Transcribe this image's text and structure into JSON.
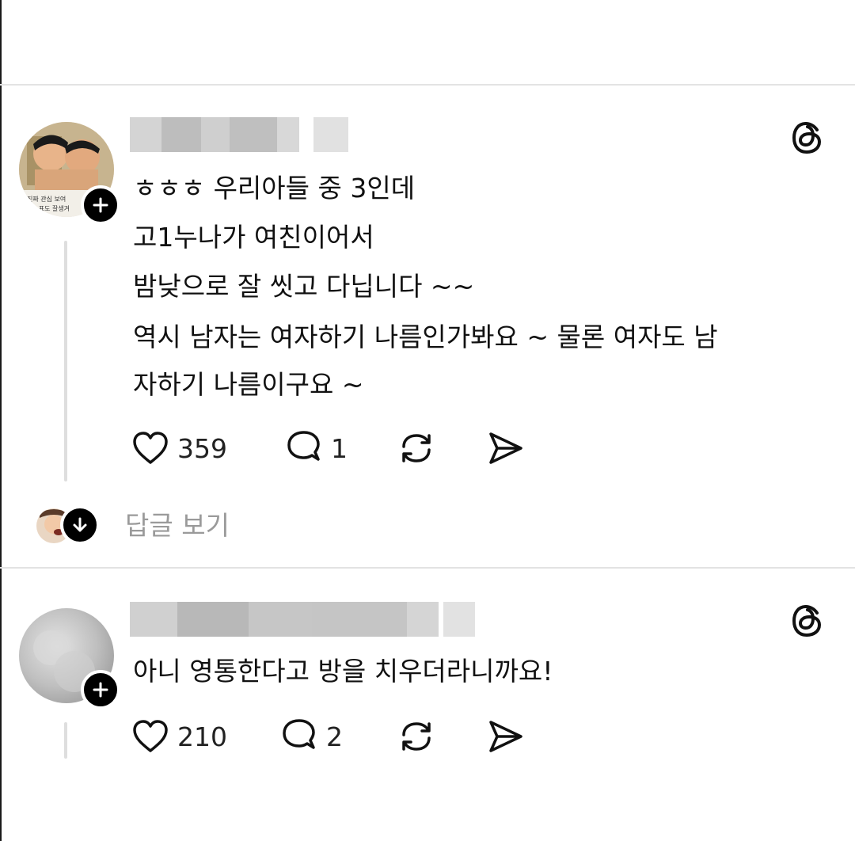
{
  "posts": [
    {
      "username": "",
      "text_lines": [
        "ㅎㅎㅎ 우리아들 중 3인데",
        "고1누나가 여친이어서",
        "밤낮으로 잘 씻고 다닙니다 ~~",
        "역시 남자는 여자하기 나름인가봐요 ~ 물론 여자도 남",
        "자하기 나름이구요 ~"
      ],
      "avatar_caption_lines": [
        "진짜 관심 보여",
        "~표도 잘생겨"
      ],
      "likes": "359",
      "comments": "1",
      "view_replies_label": "답글 보기"
    },
    {
      "username": "",
      "text_lines": [
        "아니 영통한다고 방을 치우더라니까요!"
      ],
      "likes": "210",
      "comments": "2"
    }
  ],
  "icons": {
    "threads": "threads-logo-icon",
    "like": "heart-icon",
    "comment": "comment-bubble-icon",
    "repost": "repost-icon",
    "share": "send-icon",
    "follow": "plus-icon",
    "expand": "arrow-down-icon"
  },
  "colors": {
    "text": "#111111",
    "muted": "#9a9a9a",
    "divider": "#e3e3e3",
    "badge": "#000000"
  }
}
